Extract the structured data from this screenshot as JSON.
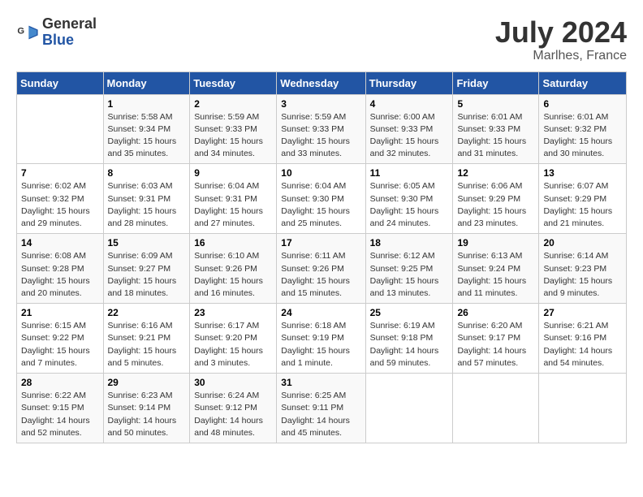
{
  "logo": {
    "text_line1": "General",
    "text_line2": "Blue"
  },
  "header": {
    "month_year": "July 2024",
    "location": "Marlhes, France"
  },
  "weekdays": [
    "Sunday",
    "Monday",
    "Tuesday",
    "Wednesday",
    "Thursday",
    "Friday",
    "Saturday"
  ],
  "weeks": [
    [
      {
        "day": "",
        "info": ""
      },
      {
        "day": "1",
        "info": "Sunrise: 5:58 AM\nSunset: 9:34 PM\nDaylight: 15 hours\nand 35 minutes."
      },
      {
        "day": "2",
        "info": "Sunrise: 5:59 AM\nSunset: 9:33 PM\nDaylight: 15 hours\nand 34 minutes."
      },
      {
        "day": "3",
        "info": "Sunrise: 5:59 AM\nSunset: 9:33 PM\nDaylight: 15 hours\nand 33 minutes."
      },
      {
        "day": "4",
        "info": "Sunrise: 6:00 AM\nSunset: 9:33 PM\nDaylight: 15 hours\nand 32 minutes."
      },
      {
        "day": "5",
        "info": "Sunrise: 6:01 AM\nSunset: 9:33 PM\nDaylight: 15 hours\nand 31 minutes."
      },
      {
        "day": "6",
        "info": "Sunrise: 6:01 AM\nSunset: 9:32 PM\nDaylight: 15 hours\nand 30 minutes."
      }
    ],
    [
      {
        "day": "7",
        "info": "Sunrise: 6:02 AM\nSunset: 9:32 PM\nDaylight: 15 hours\nand 29 minutes."
      },
      {
        "day": "8",
        "info": "Sunrise: 6:03 AM\nSunset: 9:31 PM\nDaylight: 15 hours\nand 28 minutes."
      },
      {
        "day": "9",
        "info": "Sunrise: 6:04 AM\nSunset: 9:31 PM\nDaylight: 15 hours\nand 27 minutes."
      },
      {
        "day": "10",
        "info": "Sunrise: 6:04 AM\nSunset: 9:30 PM\nDaylight: 15 hours\nand 25 minutes."
      },
      {
        "day": "11",
        "info": "Sunrise: 6:05 AM\nSunset: 9:30 PM\nDaylight: 15 hours\nand 24 minutes."
      },
      {
        "day": "12",
        "info": "Sunrise: 6:06 AM\nSunset: 9:29 PM\nDaylight: 15 hours\nand 23 minutes."
      },
      {
        "day": "13",
        "info": "Sunrise: 6:07 AM\nSunset: 9:29 PM\nDaylight: 15 hours\nand 21 minutes."
      }
    ],
    [
      {
        "day": "14",
        "info": "Sunrise: 6:08 AM\nSunset: 9:28 PM\nDaylight: 15 hours\nand 20 minutes."
      },
      {
        "day": "15",
        "info": "Sunrise: 6:09 AM\nSunset: 9:27 PM\nDaylight: 15 hours\nand 18 minutes."
      },
      {
        "day": "16",
        "info": "Sunrise: 6:10 AM\nSunset: 9:26 PM\nDaylight: 15 hours\nand 16 minutes."
      },
      {
        "day": "17",
        "info": "Sunrise: 6:11 AM\nSunset: 9:26 PM\nDaylight: 15 hours\nand 15 minutes."
      },
      {
        "day": "18",
        "info": "Sunrise: 6:12 AM\nSunset: 9:25 PM\nDaylight: 15 hours\nand 13 minutes."
      },
      {
        "day": "19",
        "info": "Sunrise: 6:13 AM\nSunset: 9:24 PM\nDaylight: 15 hours\nand 11 minutes."
      },
      {
        "day": "20",
        "info": "Sunrise: 6:14 AM\nSunset: 9:23 PM\nDaylight: 15 hours\nand 9 minutes."
      }
    ],
    [
      {
        "day": "21",
        "info": "Sunrise: 6:15 AM\nSunset: 9:22 PM\nDaylight: 15 hours\nand 7 minutes."
      },
      {
        "day": "22",
        "info": "Sunrise: 6:16 AM\nSunset: 9:21 PM\nDaylight: 15 hours\nand 5 minutes."
      },
      {
        "day": "23",
        "info": "Sunrise: 6:17 AM\nSunset: 9:20 PM\nDaylight: 15 hours\nand 3 minutes."
      },
      {
        "day": "24",
        "info": "Sunrise: 6:18 AM\nSunset: 9:19 PM\nDaylight: 15 hours\nand 1 minute."
      },
      {
        "day": "25",
        "info": "Sunrise: 6:19 AM\nSunset: 9:18 PM\nDaylight: 14 hours\nand 59 minutes."
      },
      {
        "day": "26",
        "info": "Sunrise: 6:20 AM\nSunset: 9:17 PM\nDaylight: 14 hours\nand 57 minutes."
      },
      {
        "day": "27",
        "info": "Sunrise: 6:21 AM\nSunset: 9:16 PM\nDaylight: 14 hours\nand 54 minutes."
      }
    ],
    [
      {
        "day": "28",
        "info": "Sunrise: 6:22 AM\nSunset: 9:15 PM\nDaylight: 14 hours\nand 52 minutes."
      },
      {
        "day": "29",
        "info": "Sunrise: 6:23 AM\nSunset: 9:14 PM\nDaylight: 14 hours\nand 50 minutes."
      },
      {
        "day": "30",
        "info": "Sunrise: 6:24 AM\nSunset: 9:12 PM\nDaylight: 14 hours\nand 48 minutes."
      },
      {
        "day": "31",
        "info": "Sunrise: 6:25 AM\nSunset: 9:11 PM\nDaylight: 14 hours\nand 45 minutes."
      },
      {
        "day": "",
        "info": ""
      },
      {
        "day": "",
        "info": ""
      },
      {
        "day": "",
        "info": ""
      }
    ]
  ]
}
